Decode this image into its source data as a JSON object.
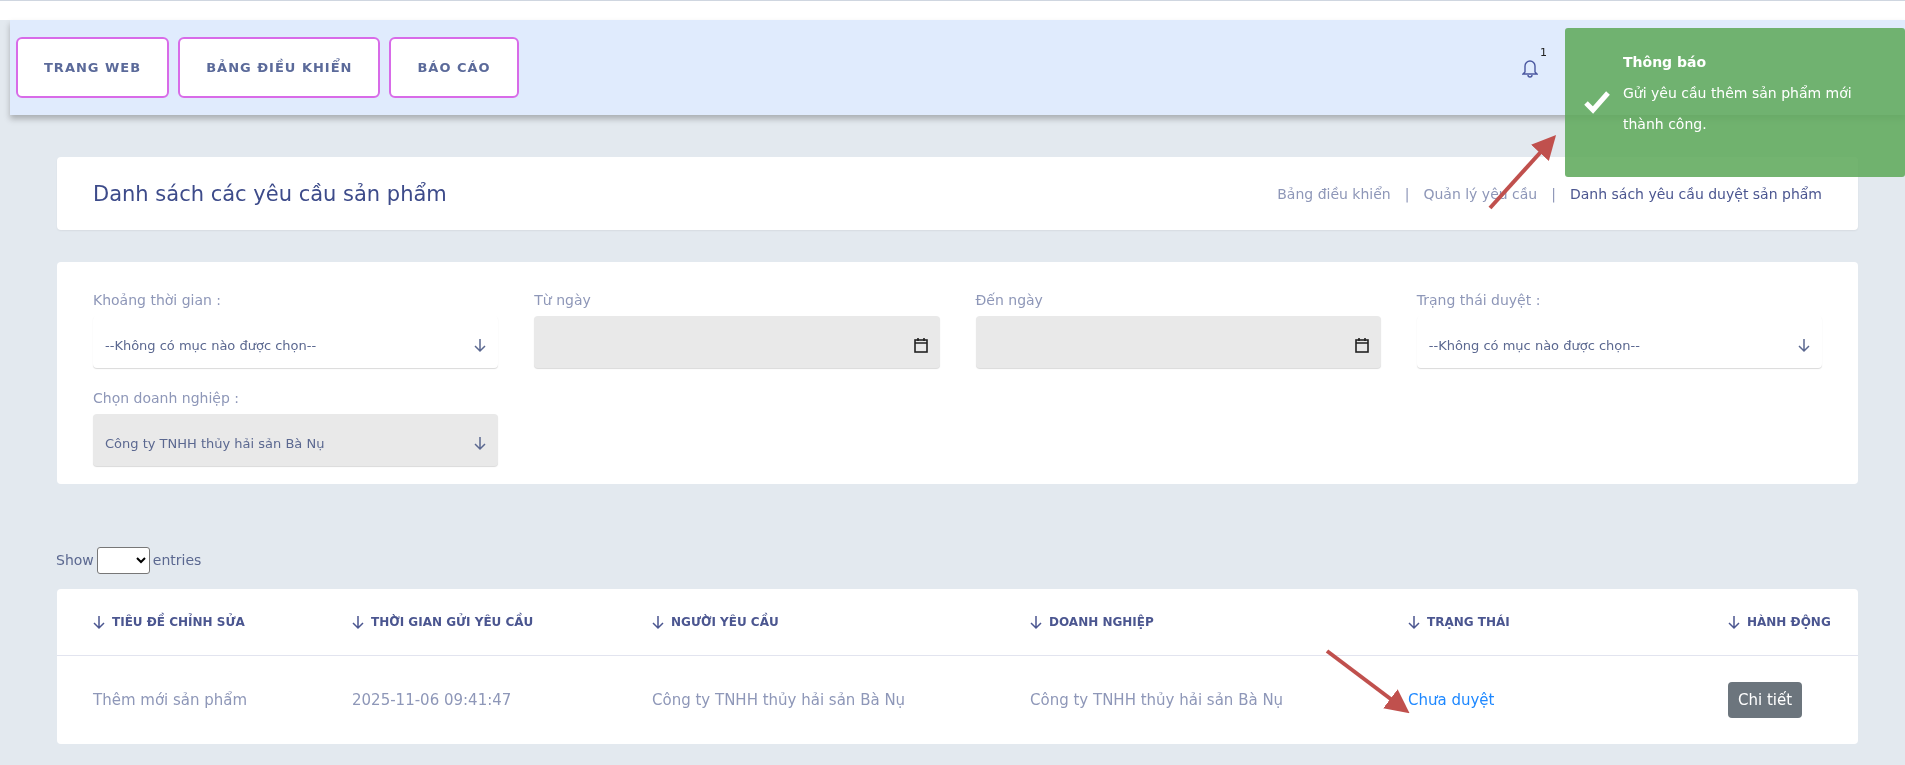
{
  "nav_buttons": [
    {
      "label": "TRANG WEB"
    },
    {
      "label": "BẢNG ĐIỀU KHIỂN"
    },
    {
      "label": "BÁO CÁO"
    }
  ],
  "notifications": {
    "count": "1"
  },
  "toast": {
    "title": "Thông báo",
    "message": "Gửi yêu cầu thêm sản phẩm mới thành công."
  },
  "page_title": "Danh sách các yêu cầu sản phẩm",
  "breadcrumbs": [
    {
      "label": "Bảng điều khiển",
      "current": false
    },
    {
      "label": "Quản lý yêu cầu",
      "current": false
    },
    {
      "label": "Danh sách yêu cầu duyệt sản phẩm",
      "current": true
    }
  ],
  "breadcrumb_separators": [
    "|",
    "|"
  ],
  "filters": [
    {
      "kind": "select",
      "label": "Khoảng thời gian :",
      "value": "--Không có mục nào được chọn--",
      "disabled": false
    },
    {
      "kind": "date",
      "label": "Từ ngày",
      "disabled": true
    },
    {
      "kind": "date",
      "label": "Đến ngày",
      "disabled": true
    },
    {
      "kind": "select",
      "label": "Trạng thái duyệt :",
      "value": "--Không có mục nào được chọn--",
      "disabled": false
    },
    {
      "kind": "select",
      "label": "Chọn doanh nghiệp :",
      "value": "Công ty TNHH thủy hải sản Bà Nụ",
      "disabled": true
    }
  ],
  "length_menu": {
    "before": "Show",
    "after": "entries"
  },
  "table": {
    "columns": [
      "TIÊU ĐỀ CHỈNH SỬA",
      "THỜI GIAN GỬI YÊU CẦU",
      "NGƯỜI YÊU CẦU",
      "DOANH NGHIỆP",
      "TRẠNG THÁI",
      "HÀNH ĐỘNG"
    ],
    "rows": [
      {
        "cells": [
          "Thêm mới sản phẩm",
          "2025-11-06 09:41:47",
          "Công ty TNHH thủy hải sản Bà Nụ",
          "Công ty TNHH thủy hải sản Bà Nụ"
        ],
        "status": "Chưa duyệt",
        "action": "Chi tiết"
      }
    ]
  }
}
